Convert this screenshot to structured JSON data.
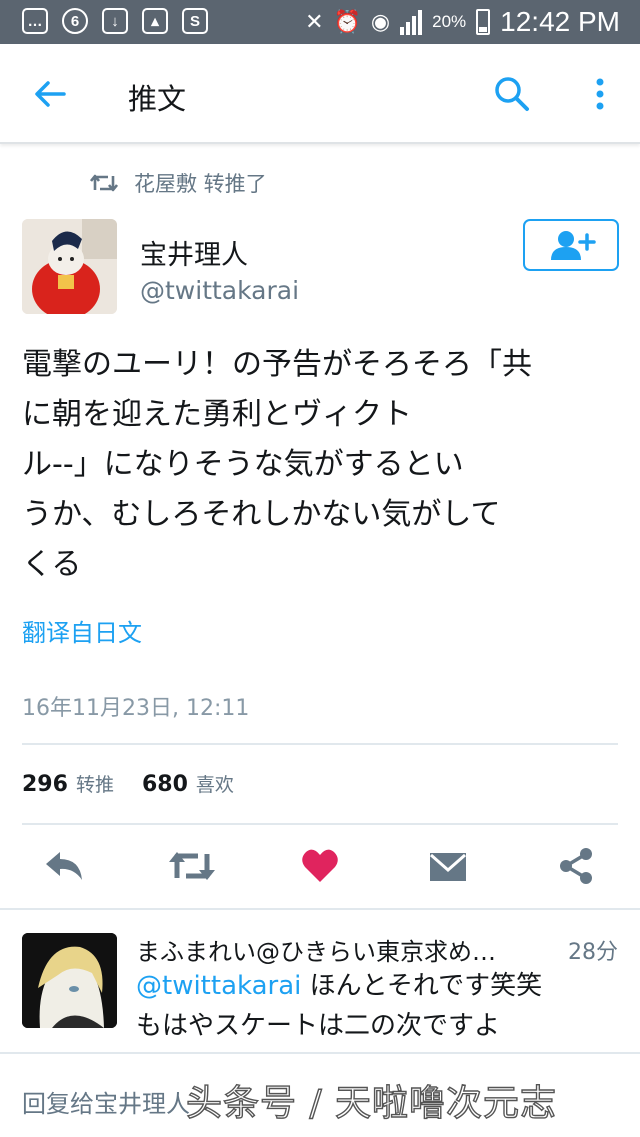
{
  "status_bar": {
    "battery_percent": "20%",
    "time": "12:42 PM"
  },
  "app_bar": {
    "title": "推文"
  },
  "retweeted_by": "花屋敷 转推了",
  "tweet": {
    "author_name": "宝井理人",
    "author_handle": "@twittakarai",
    "text": "電撃のユーリ！の予告がそろそろ「共\nに朝を迎えた勇利とヴィクト\nル‐‐」になりそうな気がするとい\nうか、むしろそれしかない気がして\nくる",
    "translate_label": "翻译自日文",
    "timestamp": "16年11月23日, 12:11",
    "retweet_count": "296",
    "retweet_label": "转推",
    "like_count": "680",
    "like_label": "喜欢",
    "liked": true
  },
  "reply": {
    "name": "まふまれい@ひきらい東京求め…",
    "time": "28分",
    "mention": "@twittakarai",
    "text_after_mention": " ほんとそれです笑笑",
    "text_line2": "もはやスケートは二の次ですよ"
  },
  "compose": {
    "placeholder": "回复给宝井理人"
  },
  "watermark": "头条号 / 天啦噜次元志",
  "colors": {
    "accent": "#1da1f2",
    "like": "#e0245e",
    "icon_gray": "#657786",
    "status_bar": "#5b6570"
  }
}
